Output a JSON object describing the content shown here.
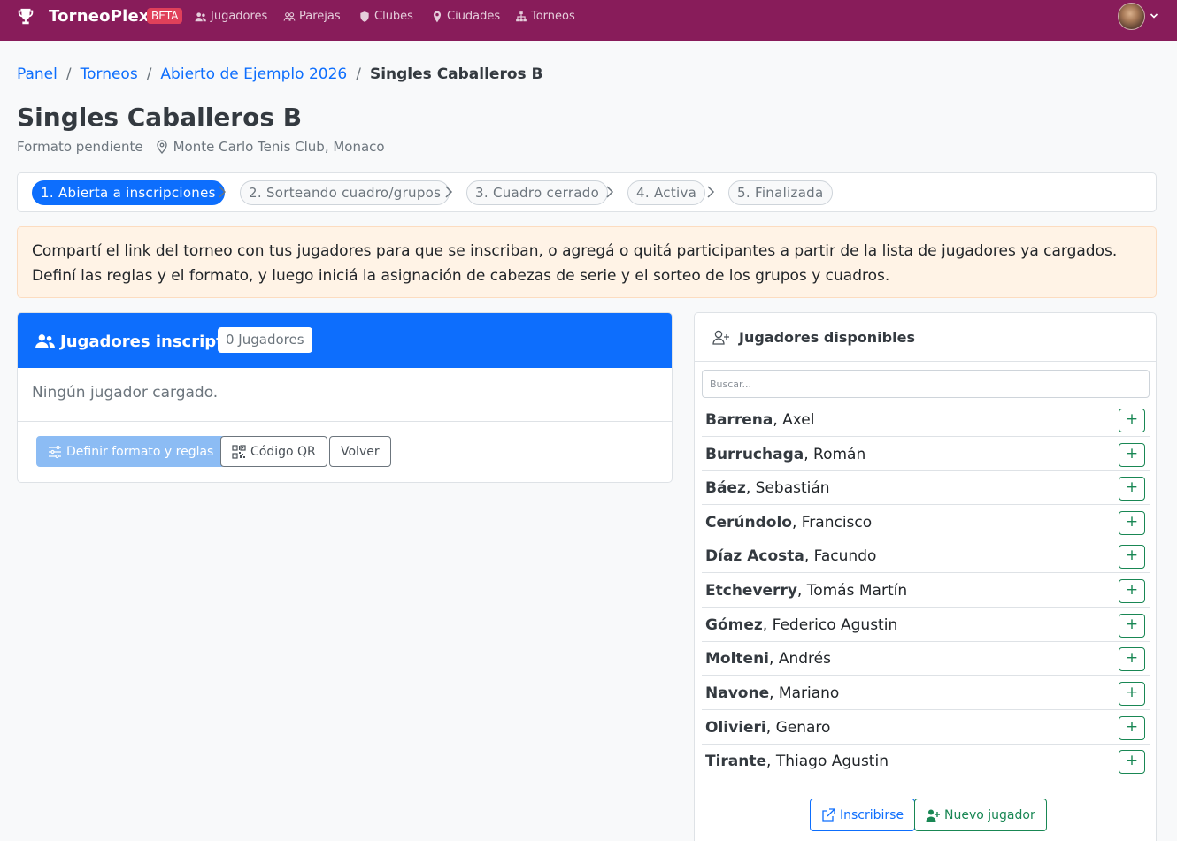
{
  "navbar": {
    "brand": "TorneoPlex",
    "beta": "BETA",
    "links": [
      {
        "label": "Jugadores",
        "icon": "users-icon"
      },
      {
        "label": "Parejas",
        "icon": "people-icon"
      },
      {
        "label": "Clubes",
        "icon": "shield-icon"
      },
      {
        "label": "Ciudades",
        "icon": "map-pin-icon"
      },
      {
        "label": "Torneos",
        "icon": "sitemap-icon"
      }
    ],
    "brand_color": "#881c5a"
  },
  "breadcrumb": [
    "Panel",
    "Torneos",
    "Abierto de Ejemplo 2026",
    "Singles Caballeros B"
  ],
  "page": {
    "title": "Singles Caballeros B",
    "format_status": "Formato pendiente",
    "location": "Monte Carlo Tenis Club, Monaco"
  },
  "steps": [
    {
      "label": "1. Abierta a inscripciones",
      "active": true
    },
    {
      "label": "2. Sorteando cuadro/grupos",
      "active": false
    },
    {
      "label": "3. Cuadro cerrado",
      "active": false
    },
    {
      "label": "4. Activa",
      "active": false
    },
    {
      "label": "5. Finalizada",
      "active": false
    }
  ],
  "alert": "Compartí el link del torneo con tus jugadores para que se inscriban, o agregá o quitá participantes a partir de la lista de jugadores ya cargados. Definí las reglas y el formato, y luego iniciá la asignación de cabezas de serie y el sorteo de los grupos y cuadros.",
  "registered": {
    "title": "Jugadores inscriptos",
    "count_badge": "0 Jugadores",
    "empty": "Ningún jugador cargado.",
    "buttons": {
      "format": "Definir formato y reglas",
      "qr": "Código QR",
      "back": "Volver"
    }
  },
  "available": {
    "title": "Jugadores disponibles",
    "search_placeholder": "Buscar...",
    "players": [
      {
        "last": "Barrena",
        "first": ", Axel"
      },
      {
        "last": "Burruchaga",
        "first": ", Román"
      },
      {
        "last": "Báez",
        "first": ", Sebastián"
      },
      {
        "last": "Cerúndolo",
        "first": ", Francisco"
      },
      {
        "last": "Díaz Acosta",
        "first": ", Facundo"
      },
      {
        "last": "Etcheverry",
        "first": ", Tomás Martín"
      },
      {
        "last": "Gómez",
        "first": ", Federico Agustin"
      },
      {
        "last": "Molteni",
        "first": ", Andrés"
      },
      {
        "last": "Navone",
        "first": ", Mariano"
      },
      {
        "last": "Olivieri",
        "first": ", Genaro"
      },
      {
        "last": "Tirante",
        "first": ", Thiago Agustin"
      }
    ],
    "add_label": "+",
    "buttons": {
      "signup": "Inscribirse",
      "new_player": "Nuevo jugador"
    }
  }
}
